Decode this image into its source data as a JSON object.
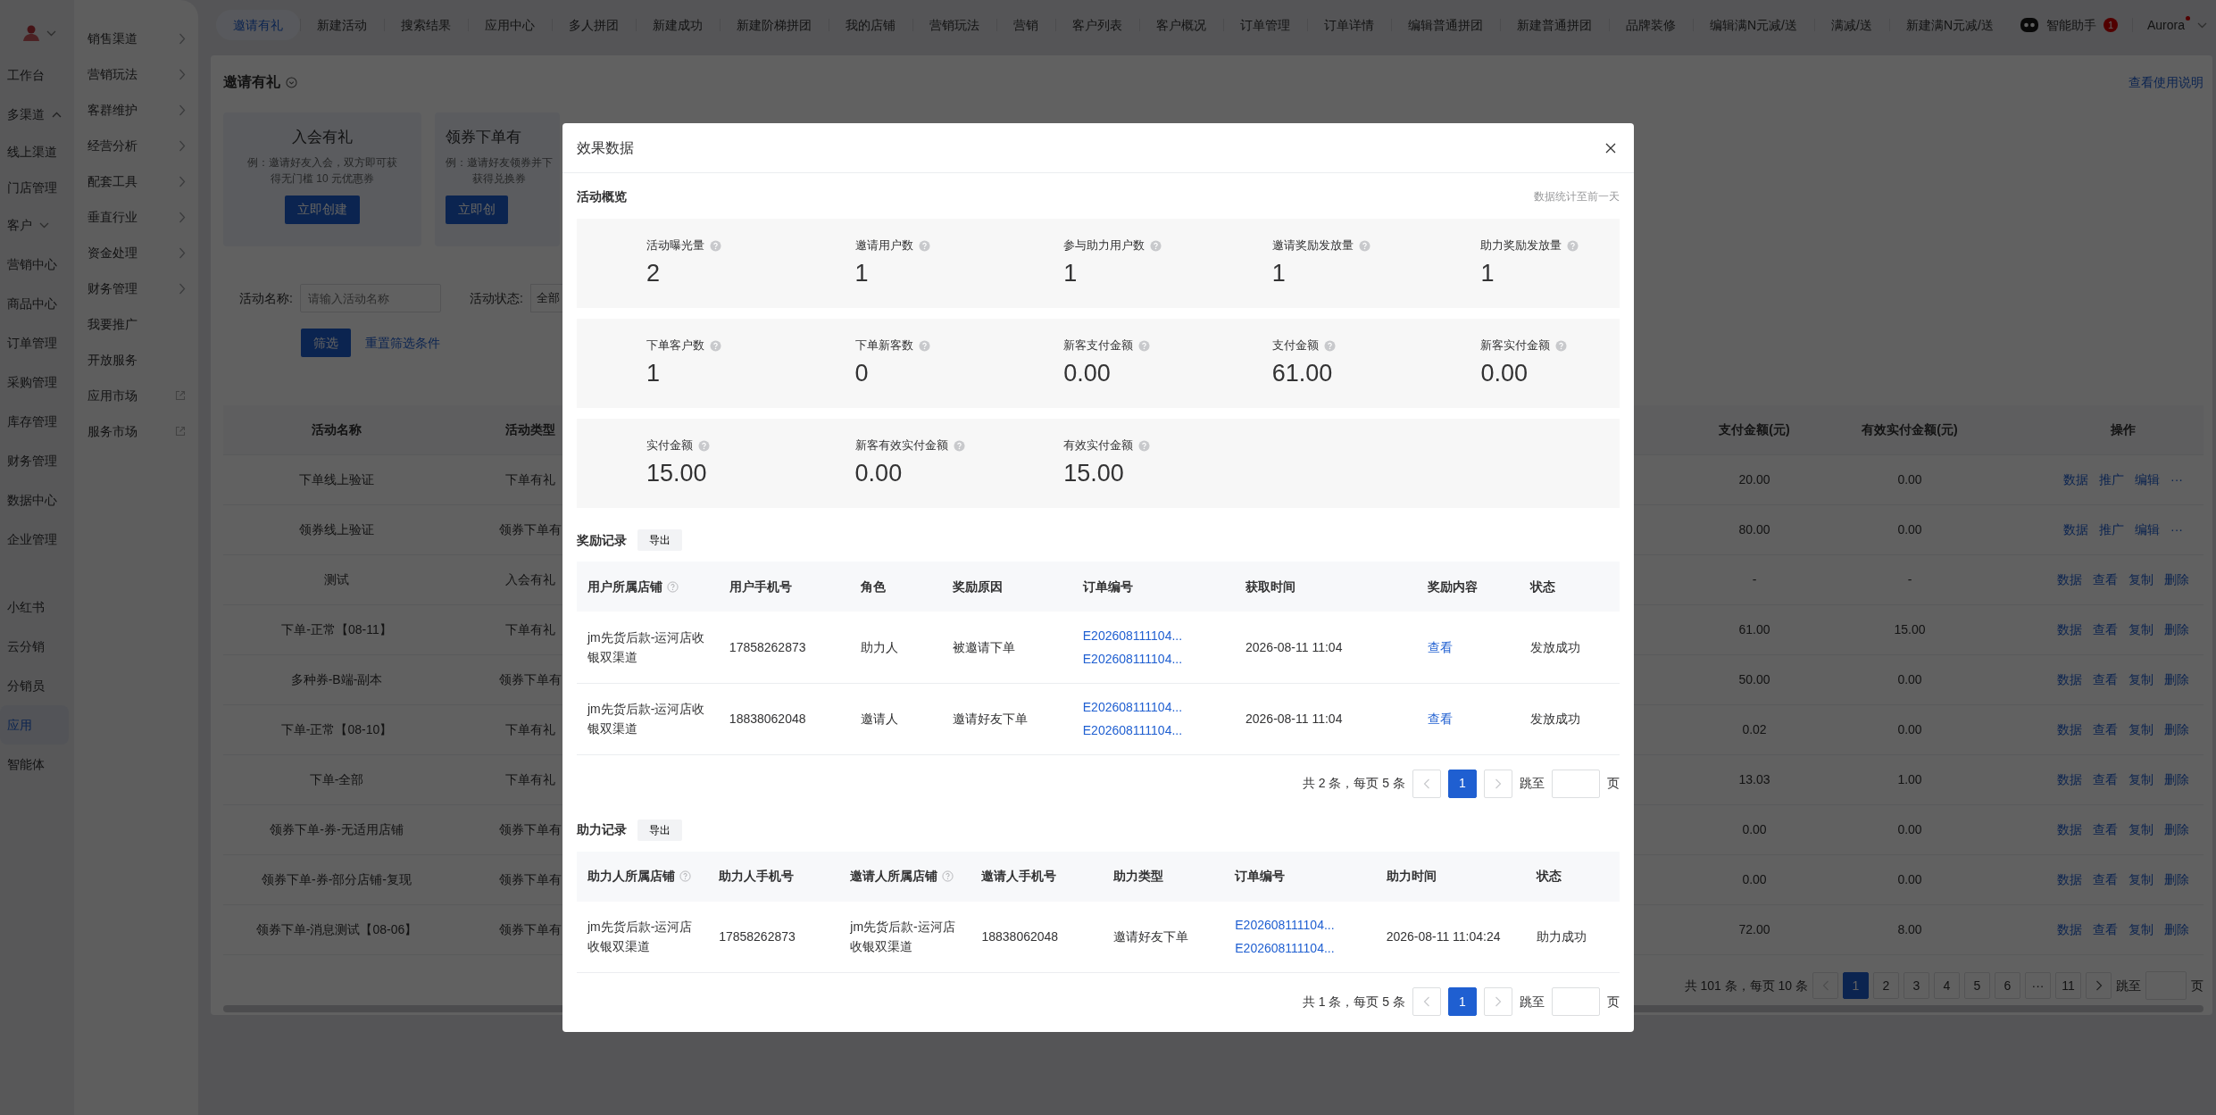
{
  "sidebar": {
    "items": [
      {
        "label": "工作台",
        "selected": false
      },
      {
        "label": "多渠道",
        "selected": false,
        "expanded": true,
        "children": [
          {
            "label": "线上渠道",
            "selected": false
          },
          {
            "label": "门店管理",
            "selected": false
          }
        ]
      },
      {
        "label": "客户",
        "selected": false,
        "expanded": false
      },
      {
        "label": "营销中心",
        "selected": false
      },
      {
        "label": "商品中心",
        "selected": false
      },
      {
        "label": "订单管理",
        "selected": false
      },
      {
        "label": "采购管理",
        "selected": false
      },
      {
        "label": "库存管理",
        "selected": false
      },
      {
        "label": "财务管理",
        "selected": false
      },
      {
        "label": "数据中心",
        "selected": false
      },
      {
        "label": "企业管理",
        "selected": false
      }
    ],
    "apps": [
      {
        "label": "小红书",
        "selected": false
      },
      {
        "label": "云分销",
        "selected": false
      },
      {
        "label": "分销员",
        "selected": false
      },
      {
        "label": "应用",
        "selected": true
      },
      {
        "label": "智能体",
        "selected": false
      }
    ]
  },
  "submenu": {
    "items": [
      {
        "label": "销售渠道",
        "kind": "arrow"
      },
      {
        "label": "营销玩法",
        "kind": "arrow"
      },
      {
        "label": "客群维护",
        "kind": "arrow"
      },
      {
        "label": "经营分析",
        "kind": "arrow"
      },
      {
        "label": "配套工具",
        "kind": "arrow"
      },
      {
        "label": "垂直行业",
        "kind": "arrow"
      },
      {
        "label": "资金处理",
        "kind": "arrow"
      },
      {
        "label": "财务管理",
        "kind": "arrow"
      },
      {
        "label": "我要推广",
        "kind": "plain"
      },
      {
        "label": "开放服务",
        "kind": "plain"
      },
      {
        "label": "应用市场",
        "kind": "external"
      },
      {
        "label": "服务市场",
        "kind": "external"
      }
    ]
  },
  "top_tabs": [
    {
      "label": "邀请有礼",
      "selected": true
    },
    {
      "label": "新建活动",
      "selected": false
    },
    {
      "label": "搜索结果",
      "selected": false
    },
    {
      "label": "应用中心",
      "selected": false
    },
    {
      "label": "多人拼团",
      "selected": false
    },
    {
      "label": "新建成功",
      "selected": false
    },
    {
      "label": "新建阶梯拼团",
      "selected": false
    },
    {
      "label": "我的店铺",
      "selected": false
    },
    {
      "label": "营销玩法",
      "selected": false
    },
    {
      "label": "营销",
      "selected": false
    },
    {
      "label": "客户列表",
      "selected": false
    },
    {
      "label": "客户概况",
      "selected": false
    },
    {
      "label": "订单管理",
      "selected": false
    },
    {
      "label": "订单详情",
      "selected": false
    },
    {
      "label": "编辑普通拼团",
      "selected": false
    },
    {
      "label": "新建普通拼团",
      "selected": false
    },
    {
      "label": "品牌装修",
      "selected": false
    },
    {
      "label": "编辑满N元减/送",
      "selected": false
    },
    {
      "label": "满减/送",
      "selected": false
    },
    {
      "label": "新建满N元减/送",
      "selected": false
    }
  ],
  "assistant": {
    "label": "智能助手",
    "badge": "1"
  },
  "user": {
    "name": "Aurora",
    "has_notification": true
  },
  "page": {
    "title": "邀请有礼",
    "help_link": "查看使用说明",
    "templates": [
      {
        "title": "入会有礼",
        "description": [
          "例：邀请好友入会，双方即可获",
          "得无门槛 10 元优惠券"
        ],
        "button": "立即创建"
      },
      {
        "title": "领券下单有",
        "description": [
          "例：邀请好友领券并下",
          "获得兑换券"
        ],
        "button": "立即创"
      }
    ],
    "filters": {
      "name_label": "活动名称:",
      "name_placeholder": "请输入活动名称",
      "status_label": "活动状态:",
      "status_value": "全部",
      "search_button": "筛选",
      "reset_link": "重置筛选条件"
    },
    "table": {
      "columns_left": [
        "活动名称",
        "活动类型"
      ],
      "columns_right": [
        "支付金额(元)",
        "有效实付金额(元)",
        "操作"
      ],
      "rows": [
        {
          "name": "下单线上验证",
          "type": "下单有礼",
          "pay": "20.00",
          "valid_pay": "0.00",
          "actions": [
            "数据",
            "推广",
            "编辑",
            "···"
          ]
        },
        {
          "name": "领券线上验证",
          "type": "领券下单有",
          "pay": "80.00",
          "valid_pay": "0.00",
          "actions": [
            "数据",
            "推广",
            "编辑",
            "···"
          ]
        },
        {
          "name": "测试",
          "type": "入会有礼",
          "pay": "-",
          "valid_pay": "-",
          "actions": [
            "数据",
            "查看",
            "复制",
            "删除"
          ]
        },
        {
          "name": "下单-正常【08-11】",
          "type": "下单有礼",
          "pay": "61.00",
          "valid_pay": "15.00",
          "actions": [
            "数据",
            "查看",
            "复制",
            "删除"
          ]
        },
        {
          "name": "多种券-B端-副本",
          "type": "领券下单有",
          "pay": "50.00",
          "valid_pay": "0.00",
          "actions": [
            "数据",
            "查看",
            "复制",
            "删除"
          ]
        },
        {
          "name": "下单-正常【08-10】",
          "type": "下单有礼",
          "pay": "0.02",
          "valid_pay": "0.00",
          "actions": [
            "数据",
            "查看",
            "复制",
            "删除"
          ]
        },
        {
          "name": "下单-全部",
          "type": "下单有礼",
          "pay": "13.03",
          "valid_pay": "1.00",
          "actions": [
            "数据",
            "查看",
            "复制",
            "删除"
          ]
        },
        {
          "name": "领券下单-券-无适用店铺",
          "type": "领券下单有",
          "pay": "0.00",
          "valid_pay": "0.00",
          "actions": [
            "数据",
            "查看",
            "复制",
            "删除"
          ]
        },
        {
          "name": "领券下单-券-部分店铺-复现",
          "type": "领券下单有",
          "pay": "0.00",
          "valid_pay": "0.00",
          "actions": [
            "数据",
            "查看",
            "复制",
            "删除"
          ]
        },
        {
          "name": "领券下单-消息测试【08-06】",
          "type": "领券下单有",
          "pay": "72.00",
          "valid_pay": "8.00",
          "actions": [
            "数据",
            "查看",
            "复制",
            "删除"
          ]
        }
      ]
    },
    "pagination": {
      "summary": "共 101 条，每页 10 条",
      "pages": [
        {
          "label": "1",
          "selected": true
        },
        {
          "label": "2",
          "selected": false
        },
        {
          "label": "3",
          "selected": false
        },
        {
          "label": "4",
          "selected": false
        },
        {
          "label": "5",
          "selected": false
        },
        {
          "label": "6",
          "selected": false
        },
        {
          "label": "···",
          "selected": false
        },
        {
          "label": "11",
          "selected": false
        }
      ],
      "jump_label": "跳至",
      "page_unit": "页"
    }
  },
  "modal": {
    "title": "效果数据",
    "overview": {
      "title": "活动概览",
      "note": "数据统计至前一天",
      "panels": [
        [
          {
            "label": "活动曝光量",
            "value": "2"
          },
          {
            "label": "邀请用户数",
            "value": "1"
          },
          {
            "label": "参与助力用户数",
            "value": "1"
          },
          {
            "label": "邀请奖励发放量",
            "value": "1"
          },
          {
            "label": "助力奖励发放量",
            "value": "1"
          }
        ],
        [
          {
            "label": "下单客户数",
            "value": "1"
          },
          {
            "label": "下单新客数",
            "value": "0"
          },
          {
            "label": "新客支付金额",
            "value": "0.00"
          },
          {
            "label": "支付金额",
            "value": "61.00"
          },
          {
            "label": "新客实付金额",
            "value": "0.00"
          }
        ],
        [
          {
            "label": "实付金额",
            "value": "15.00"
          },
          {
            "label": "新客有效实付金额",
            "value": "0.00"
          },
          {
            "label": "有效实付金额",
            "value": "15.00"
          }
        ]
      ]
    },
    "sections": [
      {
        "title": "奖励记录",
        "export": "导出",
        "columns": [
          {
            "label": "用户所属店铺",
            "help": true
          },
          {
            "label": "用户手机号",
            "help": false
          },
          {
            "label": "角色",
            "help": false
          },
          {
            "label": "奖励原因",
            "help": false
          },
          {
            "label": "订单编号",
            "help": false
          },
          {
            "label": "获取时间",
            "help": false
          },
          {
            "label": "奖励内容",
            "help": false
          },
          {
            "label": "状态",
            "help": false
          }
        ],
        "rows": [
          [
            {
              "kind": "text",
              "text": "jm先货后款-运河店收银双渠道"
            },
            {
              "kind": "text",
              "text": "17858262873"
            },
            {
              "kind": "text",
              "text": "助力人"
            },
            {
              "kind": "text",
              "text": "被邀请下单"
            },
            {
              "kind": "links",
              "links": [
                "E202608111104...",
                "E202608111104..."
              ]
            },
            {
              "kind": "text",
              "text": "2026-08-11 11:04"
            },
            {
              "kind": "link",
              "text": "查看"
            },
            {
              "kind": "text",
              "text": "发放成功"
            }
          ],
          [
            {
              "kind": "text",
              "text": "jm先货后款-运河店收银双渠道"
            },
            {
              "kind": "text",
              "text": "18838062048"
            },
            {
              "kind": "text",
              "text": "邀请人"
            },
            {
              "kind": "text",
              "text": "邀请好友下单"
            },
            {
              "kind": "links",
              "links": [
                "E202608111104...",
                "E202608111104..."
              ]
            },
            {
              "kind": "text",
              "text": "2026-08-11 11:04"
            },
            {
              "kind": "link",
              "text": "查看"
            },
            {
              "kind": "text",
              "text": "发放成功"
            }
          ]
        ],
        "pagination": {
          "summary": "共 2 条，每页 5 条",
          "pages": [
            {
              "label": "1",
              "selected": true
            }
          ],
          "jump_label": "跳至",
          "page_unit": "页"
        }
      },
      {
        "title": "助力记录",
        "export": "导出",
        "columns": [
          {
            "label": "助力人所属店铺",
            "help": true
          },
          {
            "label": "助力人手机号",
            "help": false
          },
          {
            "label": "邀请人所属店铺",
            "help": true
          },
          {
            "label": "邀请人手机号",
            "help": false
          },
          {
            "label": "助力类型",
            "help": false
          },
          {
            "label": "订单编号",
            "help": false
          },
          {
            "label": "助力时间",
            "help": false
          },
          {
            "label": "状态",
            "help": false
          }
        ],
        "rows": [
          [
            {
              "kind": "text",
              "text": "jm先货后款-运河店收银双渠道"
            },
            {
              "kind": "text",
              "text": "17858262873"
            },
            {
              "kind": "text",
              "text": "jm先货后款-运河店收银双渠道"
            },
            {
              "kind": "text",
              "text": "18838062048"
            },
            {
              "kind": "text",
              "text": "邀请好友下单"
            },
            {
              "kind": "links",
              "links": [
                "E202608111104...",
                "E202608111104..."
              ]
            },
            {
              "kind": "text",
              "text": "2026-08-11 11:04:24"
            },
            {
              "kind": "text",
              "text": "助力成功"
            }
          ]
        ],
        "pagination": {
          "summary": "共 1 条，每页 5 条",
          "pages": [
            {
              "label": "1",
              "selected": true
            }
          ],
          "jump_label": "跳至",
          "page_unit": "页"
        }
      }
    ]
  }
}
